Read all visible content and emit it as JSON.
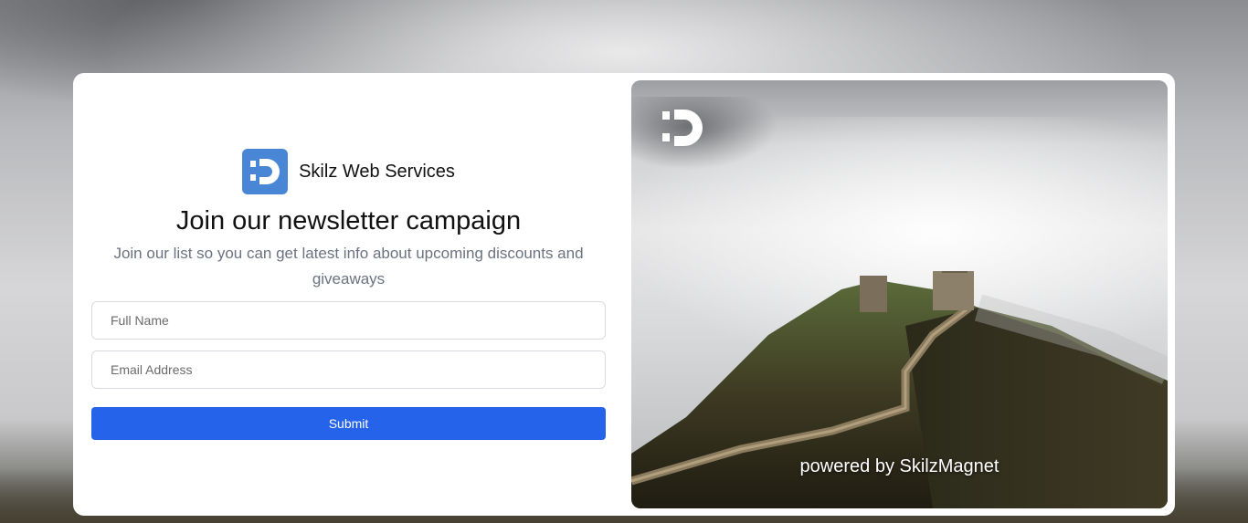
{
  "brand": {
    "name": "Skilz Web Services",
    "logo_icon": "skilz-d-logo-icon",
    "logo_color": "#4a86d6"
  },
  "newsletter": {
    "title": "Join our newsletter campaign",
    "subtitle": "Join our list so you can get latest info about upcoming discounts and giveaways"
  },
  "form": {
    "full_name_placeholder": "Full Name",
    "full_name_value": "",
    "email_placeholder": "Email Address",
    "email_value": "",
    "submit_label": "Submit",
    "submit_color": "#2563eb"
  },
  "hero": {
    "logo_icon": "skilz-d-logo-icon",
    "caption": "powered by SkilzMagnet"
  }
}
